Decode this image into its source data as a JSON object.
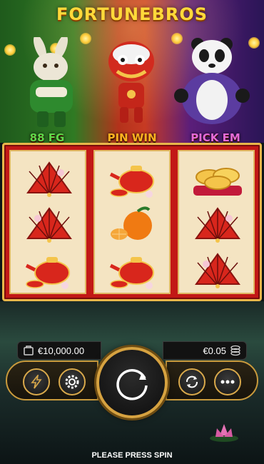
{
  "game": {
    "title": "FORTUNEBROS"
  },
  "features": [
    {
      "label": "88 FG",
      "color": "#5fd94a"
    },
    {
      "label": "PIN WIN",
      "color": "#ffb21f"
    },
    {
      "label": "PICK EM",
      "color": "#e46ad8"
    }
  ],
  "reels": [
    [
      "fan-icon",
      "fan-icon",
      "teapot-icon"
    ],
    [
      "teapot-icon",
      "orange-icon",
      "teapot-icon"
    ],
    [
      "gold-ingot-icon",
      "fan-icon",
      "fan-icon"
    ]
  ],
  "balance": {
    "amount": "€10,000.00",
    "icon": "wallet-icon"
  },
  "bet": {
    "amount": "€0.05",
    "icon": "coins-icon"
  },
  "controls": {
    "turbo": "lightning-icon",
    "settings": "gear-icon",
    "spin": "spin-icon",
    "autoplay": "autoplay-icon",
    "menu": "more-icon"
  },
  "status": "PLEASE PRESS SPIN"
}
